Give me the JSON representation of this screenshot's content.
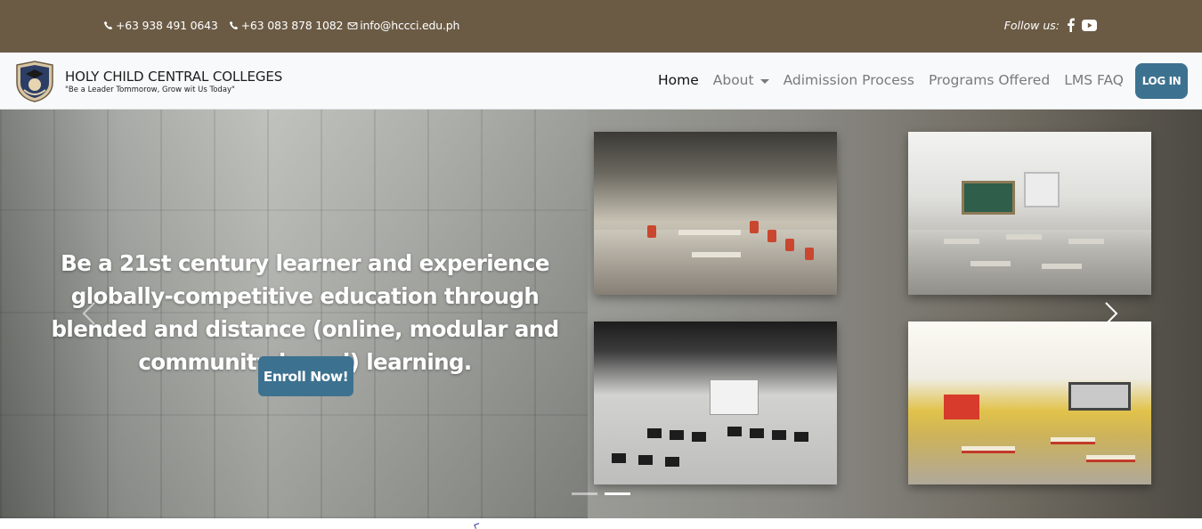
{
  "topbar": {
    "phone1": "+63 938 491 0643",
    "phone2": "+63 083 878 1082",
    "email": "info@hccci.edu.ph",
    "follow_label": "Follow us:",
    "icons": [
      "phone-icon",
      "envelope-icon",
      "facebook-icon",
      "youtube-icon"
    ]
  },
  "navbar": {
    "brand_name": "HOLY CHILD CENTRAL COLLEGES",
    "brand_tagline": "\"Be a Leader Tommorow, Grow wit Us Today\"",
    "links": [
      {
        "label": "Home",
        "active": true
      },
      {
        "label": "About",
        "dropdown": true
      },
      {
        "label": "Adimission Process"
      },
      {
        "label": "Programs Offered"
      },
      {
        "label": "LMS FAQ"
      }
    ],
    "login_label": "LOG IN"
  },
  "hero": {
    "headline": "Be a 21st century learner and experience globally-competitive education through blended and distance (online, modular and community-based) learning.",
    "cta_label": "Enroll Now!",
    "slide_count": 2,
    "active_slide": 2
  },
  "colors": {
    "topbar_bg": "#6b5b45",
    "accent": "#3d7190",
    "navbar_bg": "#f8f9fa"
  }
}
